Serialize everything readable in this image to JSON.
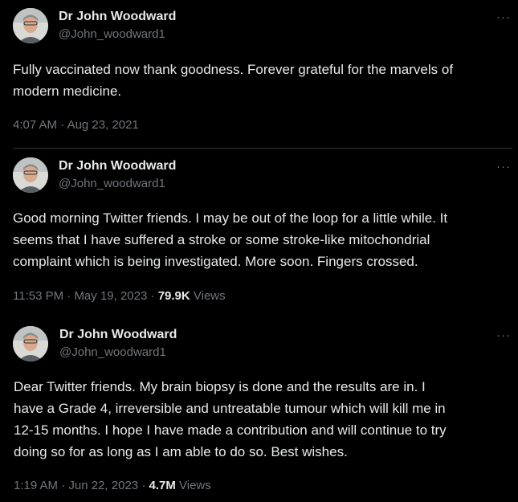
{
  "tweets": [
    {
      "author": "Dr John Woodward",
      "handle": "@John_woodward1",
      "text": "Fully vaccinated now thank goodness.  Forever grateful for the marvels of\nmodern medicine.",
      "time": "4:07 AM",
      "date": "Aug 23, 2021",
      "views_count": "",
      "views_label": ""
    },
    {
      "author": "Dr John Woodward",
      "handle": "@John_woodward1",
      "text": "Good morning Twitter friends. I may be out of the loop for a little while. It\nseems that I have suffered a stroke or some stroke-like mitochondrial\ncomplaint which is being investigated. More soon. Fingers crossed.",
      "time": "11:53 PM",
      "date": "May 19, 2023",
      "views_count": "79.9K",
      "views_label": "Views"
    },
    {
      "author": "Dr John Woodward",
      "handle": "@John_woodward1",
      "text": "Dear Twitter friends. My brain biopsy is done and the results are in. I\nhave a Grade 4, irreversible and untreatable tumour which will kill me in\n12-15 months. I hope I have made a contribution and will continue to try\ndoing so for as long as I am able to do so. Best wishes.",
      "time": "1:19 AM",
      "date": "Jun 22, 2023",
      "views_count": "4.7M",
      "views_label": "Views"
    }
  ],
  "separator": "·",
  "more_icon": "···",
  "colors": {
    "background": "#000000",
    "text": "#e7e9ea",
    "secondary": "#71767b",
    "divider": "#2f3336"
  }
}
